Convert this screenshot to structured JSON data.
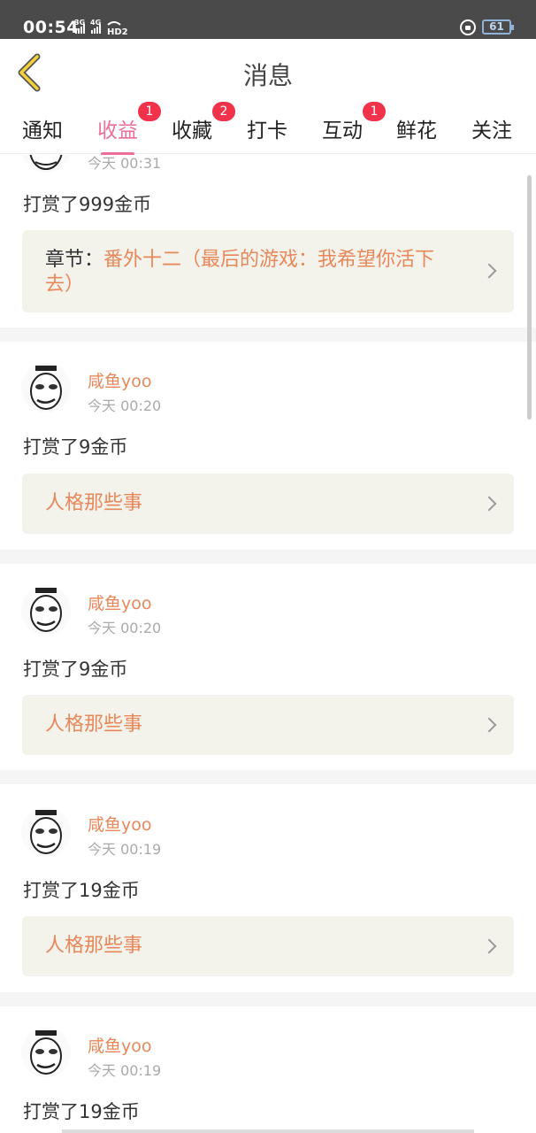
{
  "status_bar": {
    "time": "00:54",
    "signal_text": "3G 4G HD2",
    "battery": "61"
  },
  "header": {
    "title": "消息"
  },
  "tabs": [
    {
      "label": "通知",
      "badge": ""
    },
    {
      "label": "收益",
      "badge": "1"
    },
    {
      "label": "收藏",
      "badge": "2"
    },
    {
      "label": "打卡",
      "badge": ""
    },
    {
      "label": "互动",
      "badge": "1"
    },
    {
      "label": "鲜花",
      "badge": ""
    },
    {
      "label": "关注",
      "badge": ""
    }
  ],
  "active_tab": "收益",
  "accent_color": "#ec6f97",
  "name_color": "#e8885a",
  "feed": [
    {
      "username": "",
      "time": "今天 00:31",
      "action": "打赏了999金币",
      "target_prefix": "章节：",
      "target": "番外十二（最后的游戏：我希望你活下去）"
    },
    {
      "username": "咸鱼yoo",
      "time": "今天 00:20",
      "action": "打赏了9金币",
      "target_prefix": "",
      "target": "人格那些事"
    },
    {
      "username": "咸鱼yoo",
      "time": "今天 00:20",
      "action": "打赏了9金币",
      "target_prefix": "",
      "target": "人格那些事"
    },
    {
      "username": "咸鱼yoo",
      "time": "今天 00:19",
      "action": "打赏了19金币",
      "target_prefix": "",
      "target": "人格那些事"
    },
    {
      "username": "咸鱼yoo",
      "time": "今天 00:19",
      "action": "打赏了19金币",
      "target_prefix": "",
      "target": ""
    }
  ],
  "icons": [
    "back-arrow-icon",
    "lock-icon",
    "battery-icon",
    "chevron-right-icon",
    "avatar-meme-icon"
  ]
}
